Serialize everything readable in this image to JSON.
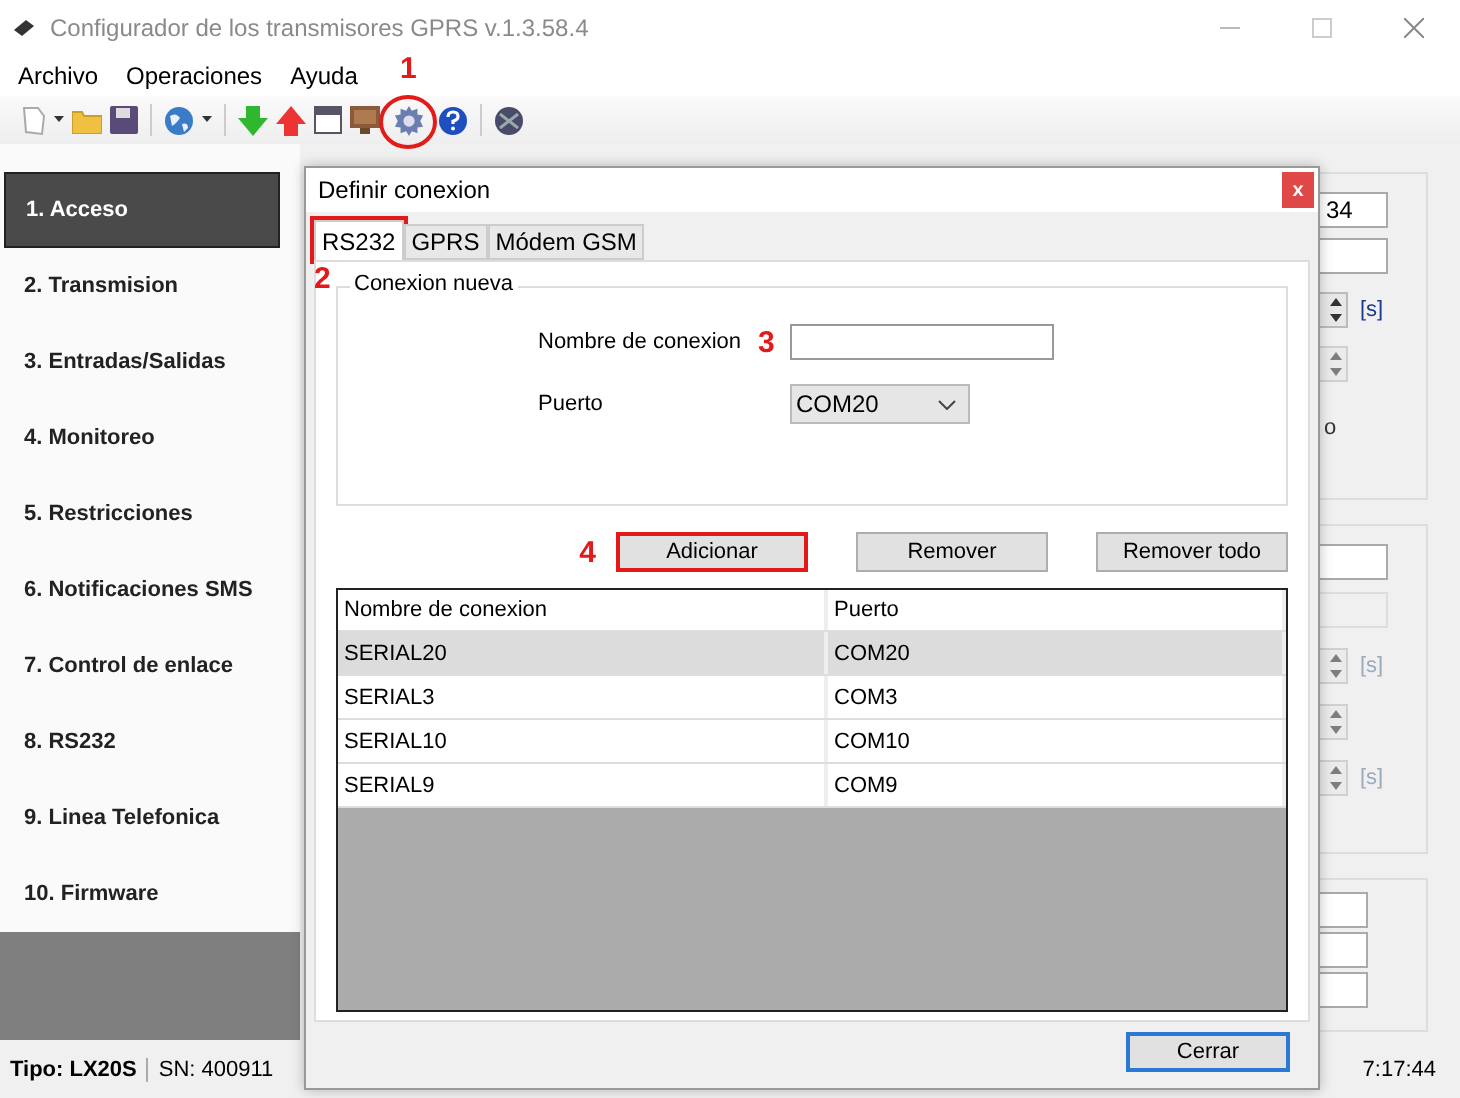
{
  "window": {
    "title": "Configurador de los transmisores GPRS v.1.3.58.4"
  },
  "menu": [
    "Archivo",
    "Operaciones",
    "Ayuda"
  ],
  "toolbar": {
    "callout": "1"
  },
  "sidebar": {
    "items": [
      {
        "label": "1. Acceso",
        "selected": true
      },
      {
        "label": "2. Transmision",
        "selected": false
      },
      {
        "label": "3. Entradas/Salidas",
        "selected": false
      },
      {
        "label": "4. Monitoreo",
        "selected": false
      },
      {
        "label": "5. Restricciones",
        "selected": false
      },
      {
        "label": "6. Notificaciones SMS",
        "selected": false
      },
      {
        "label": "7. Control de enlace",
        "selected": false
      },
      {
        "label": "8. RS232",
        "selected": false
      },
      {
        "label": "9. Linea Telefonica",
        "selected": false
      },
      {
        "label": "10. Firmware",
        "selected": false
      }
    ]
  },
  "background_panel": {
    "field_value": "34",
    "units": [
      {
        "label": "[s]",
        "disabled": false
      },
      {
        "label": "[s]",
        "disabled": true
      },
      {
        "label": "[s]",
        "disabled": true
      }
    ],
    "fragment": "o"
  },
  "dialog": {
    "title": "Definir conexion",
    "close": "x",
    "tabs": [
      {
        "label": "RS232",
        "selected": true,
        "callout": "2"
      },
      {
        "label": "GPRS",
        "selected": false
      },
      {
        "label": "Módem GSM",
        "selected": false
      }
    ],
    "group": {
      "title": "Conexion nueva",
      "name_label": "Nombre de conexion",
      "name_callout": "3",
      "port_label": "Puerto",
      "port_value": "COM20"
    },
    "buttons": [
      {
        "label": "Adicionar",
        "callout": "4"
      },
      {
        "label": "Remover"
      },
      {
        "label": "Remover todo"
      }
    ],
    "table": {
      "columns": [
        "Nombre de conexion",
        "Puerto"
      ],
      "rows": [
        {
          "cells": [
            "SERIAL20",
            "COM20"
          ],
          "selected": true
        },
        {
          "cells": [
            "SERIAL3",
            "COM3"
          ],
          "selected": false
        },
        {
          "cells": [
            "SERIAL10",
            "COM10"
          ],
          "selected": false
        },
        {
          "cells": [
            "SERIAL9",
            "COM9"
          ],
          "selected": false
        }
      ]
    },
    "close_button": "Cerrar"
  },
  "status_bar": {
    "type": "Tipo: LX20S",
    "serial": "SN: 400911",
    "time": "7:17:44"
  }
}
